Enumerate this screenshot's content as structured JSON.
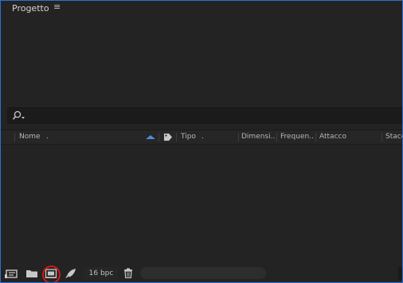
{
  "panel": {
    "title": "Progetto",
    "menu_glyph": "≡"
  },
  "search": {
    "value": "",
    "placeholder": ""
  },
  "columns": {
    "name": "Nome",
    "name_dot": ".",
    "type": "Tipo",
    "type_dot": ".",
    "dimensions": "Dimensi...",
    "frequency": "Frequen...",
    "attack": "Attacco",
    "detach": "Stacco"
  },
  "footer": {
    "bpc": "16 bpc"
  },
  "colors": {
    "panel_border": "#2f6fce",
    "sort_arrow": "#4a8ddb",
    "highlight_ring": "#d21818"
  },
  "icons": {
    "search": "search-icon",
    "panel_menu": "hamburger-menu-icon",
    "label_tag": "tag-icon",
    "interpret_footage": "interpret-footage-icon",
    "new_folder": "folder-icon",
    "new_composition": "new-composition-icon",
    "adobe_media_encoder": "rocket-icon",
    "delete": "trash-icon"
  }
}
